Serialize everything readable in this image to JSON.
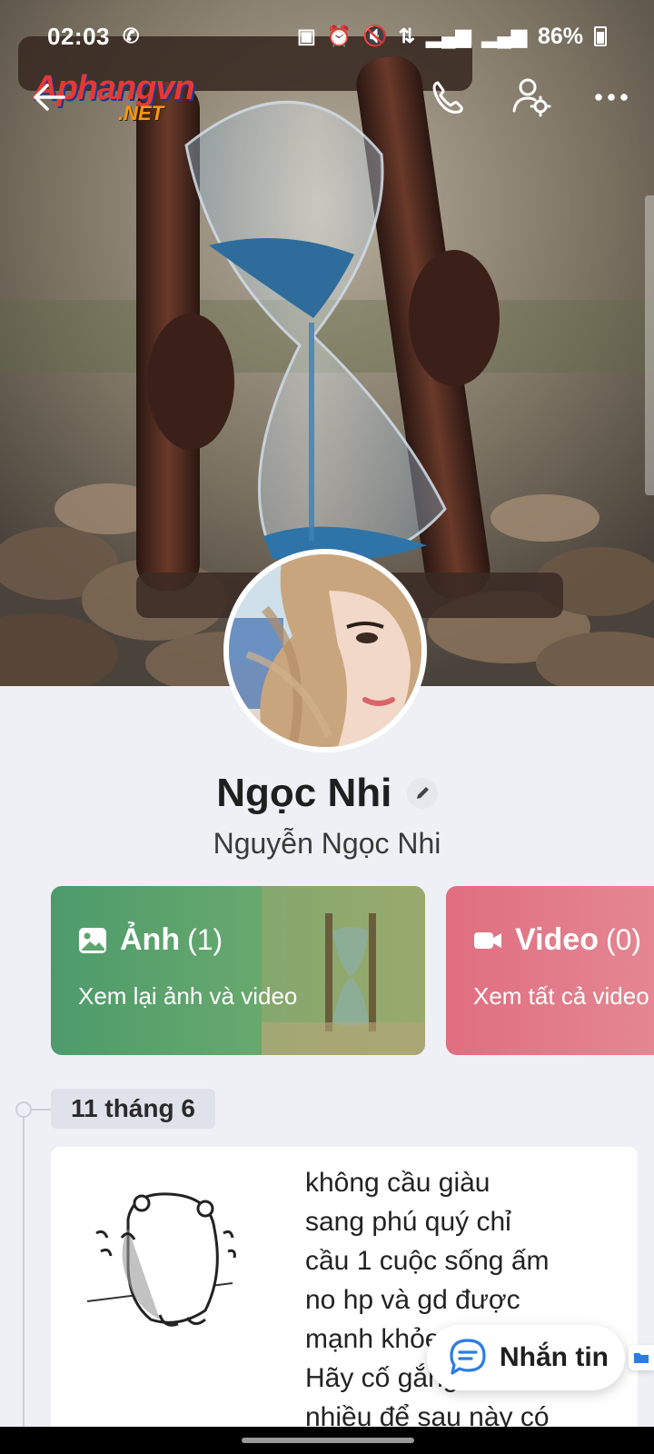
{
  "status_bar": {
    "time": "02:03",
    "battery": "86%",
    "icons": [
      "missed-call-icon",
      "folder-icon",
      "alarm-icon",
      "mute-icon",
      "data-transfer-icon",
      "signal-icon",
      "signal-icon",
      "battery-charging-icon"
    ]
  },
  "watermark": {
    "main": "Aphangvn",
    "suffix": ".NET"
  },
  "nav": {
    "icons": [
      "back-arrow-icon",
      "phone-icon",
      "user-settings-icon",
      "more-dots-icon"
    ]
  },
  "profile": {
    "display_name": "Ngọc Nhi",
    "real_name": "Nguyễn Ngọc Nhi"
  },
  "media": {
    "photos": {
      "title": "Ảnh",
      "count": "(1)",
      "subtitle": "Xem lại ảnh và video"
    },
    "videos": {
      "title": "Video",
      "count": "(0)",
      "subtitle": "Xem tất cả video"
    }
  },
  "timeline": {
    "date_label": "11 tháng 6",
    "post_lines": [
      "không cầu giàu",
      "sang phú quý chỉ",
      "cầu 1 cuộc sống ấm",
      "no hp và gd được",
      "mạnh khỏe",
      "Hãy cố gắng",
      "nhiều để sau này có"
    ]
  },
  "actions": {
    "message_label": "Nhắn tin"
  },
  "colors": {
    "photo_card": "#5fa46d",
    "video_card": "#e07080",
    "background": "#eef0f5"
  }
}
